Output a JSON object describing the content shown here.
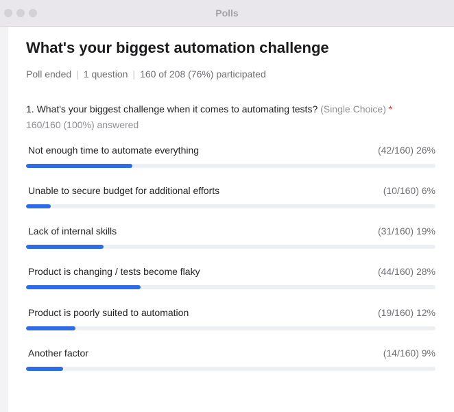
{
  "window": {
    "title": "Polls"
  },
  "poll": {
    "title": "What's your biggest automation challenge",
    "meta": {
      "status": "Poll ended",
      "questions": "1 question",
      "participation": "160 of 208 (76%) participated"
    },
    "question": {
      "text": "1. What's your biggest challenge when it comes to automating tests?",
      "type": "(Single Choice)",
      "required_marker": "*",
      "answered": "160/160 (100%) answered"
    },
    "options": [
      {
        "label": "Not enough time to automate everything",
        "count": "(42/160) 26%",
        "percent": 26
      },
      {
        "label": "Unable to secure budget for additional efforts",
        "count": "(10/160) 6%",
        "percent": 6
      },
      {
        "label": "Lack of internal skills",
        "count": "(31/160) 19%",
        "percent": 19
      },
      {
        "label": "Product is changing / tests become flaky",
        "count": "(44/160) 28%",
        "percent": 28
      },
      {
        "label": "Product is poorly suited to automation",
        "count": "(19/160) 12%",
        "percent": 12
      },
      {
        "label": "Another factor",
        "count": "(14/160) 9%",
        "percent": 9
      }
    ]
  },
  "colors": {
    "accent": "#2d6ce4",
    "track": "#eceff3",
    "required": "#e0332f"
  }
}
